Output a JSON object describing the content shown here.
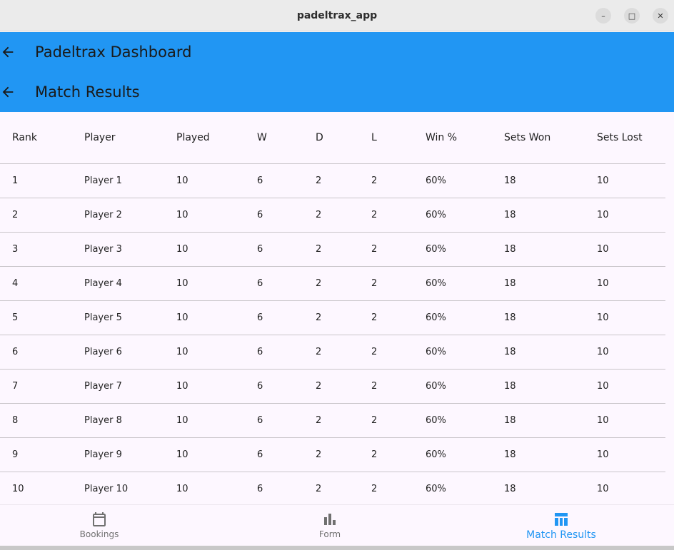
{
  "window": {
    "title": "padeltrax_app",
    "minimize_glyph": "–",
    "maximize_glyph": "□",
    "close_glyph": "✕"
  },
  "appbars": [
    {
      "title": "Padeltrax Dashboard",
      "icon": "arrow-back-icon"
    },
    {
      "title": "Match Results",
      "icon": "arrow-back-icon"
    }
  ],
  "table": {
    "headers": [
      "Rank",
      "Player",
      "Played",
      "W",
      "D",
      "L",
      "Win %",
      "Sets Won",
      "Sets Lost"
    ],
    "rows": [
      [
        "1",
        "Player 1",
        "10",
        "6",
        "2",
        "2",
        "60%",
        "18",
        "10"
      ],
      [
        "2",
        "Player 2",
        "10",
        "6",
        "2",
        "2",
        "60%",
        "18",
        "10"
      ],
      [
        "3",
        "Player 3",
        "10",
        "6",
        "2",
        "2",
        "60%",
        "18",
        "10"
      ],
      [
        "4",
        "Player 4",
        "10",
        "6",
        "2",
        "2",
        "60%",
        "18",
        "10"
      ],
      [
        "5",
        "Player 5",
        "10",
        "6",
        "2",
        "2",
        "60%",
        "18",
        "10"
      ],
      [
        "6",
        "Player 6",
        "10",
        "6",
        "2",
        "2",
        "60%",
        "18",
        "10"
      ],
      [
        "7",
        "Player 7",
        "10",
        "6",
        "2",
        "2",
        "60%",
        "18",
        "10"
      ],
      [
        "8",
        "Player 8",
        "10",
        "6",
        "2",
        "2",
        "60%",
        "18",
        "10"
      ],
      [
        "9",
        "Player 9",
        "10",
        "6",
        "2",
        "2",
        "60%",
        "18",
        "10"
      ],
      [
        "10",
        "Player 10",
        "10",
        "6",
        "2",
        "2",
        "60%",
        "18",
        "10"
      ]
    ]
  },
  "bottom_nav": {
    "items": [
      {
        "label": "Bookings",
        "icon": "calendar-icon",
        "active": false
      },
      {
        "label": "Form",
        "icon": "bar-chart-icon",
        "active": false
      },
      {
        "label": "Match Results",
        "icon": "table-icon",
        "active": true
      }
    ]
  },
  "colors": {
    "primary": "#2196f3",
    "background": "#fdf7ff",
    "divider": "#c9c5ca",
    "inactive_nav": "#707070"
  }
}
